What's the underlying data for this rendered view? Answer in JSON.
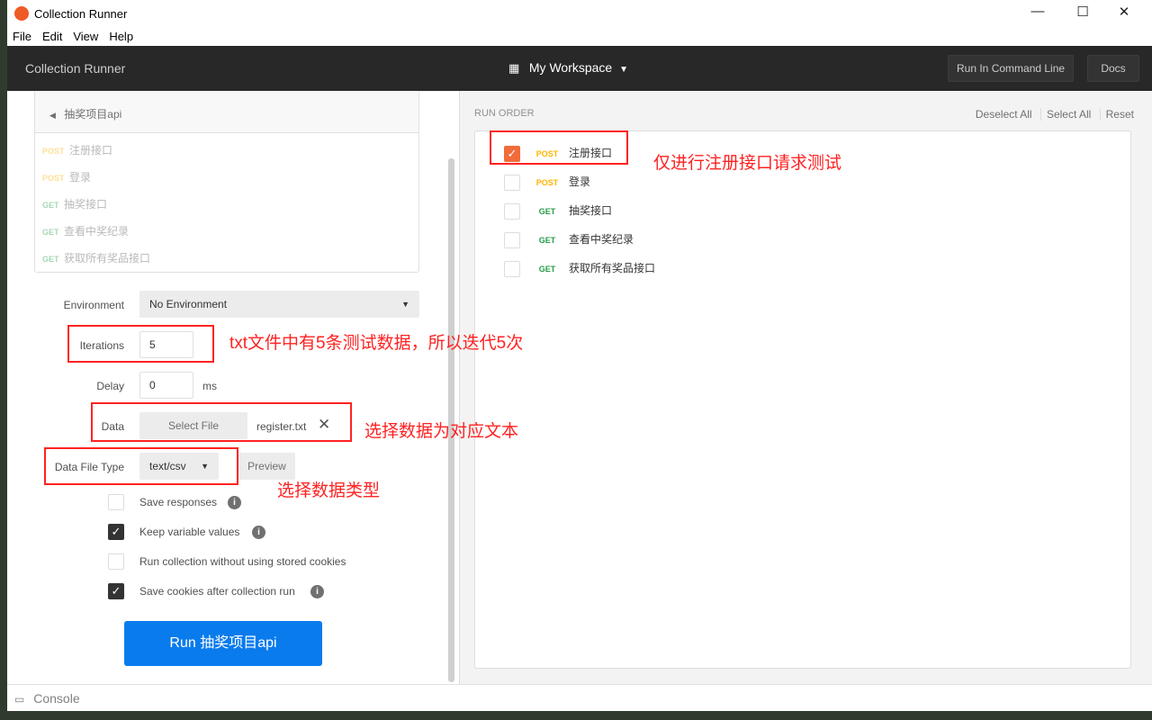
{
  "window": {
    "title": "Collection Runner",
    "controls": [
      "—",
      "☐",
      "✕"
    ]
  },
  "menu": [
    "File",
    "Edit",
    "View",
    "Help"
  ],
  "header": {
    "title": "Collection Runner",
    "workspace": "My Workspace",
    "run_cli": "Run In Command Line",
    "docs": "Docs"
  },
  "collection": {
    "name": "抽奖项目api",
    "requests": [
      {
        "method": "POST",
        "name": "注册接口"
      },
      {
        "method": "POST",
        "name": "登录"
      },
      {
        "method": "GET",
        "name": "抽奖接口"
      },
      {
        "method": "GET",
        "name": "查看中奖纪录"
      },
      {
        "method": "GET",
        "name": "获取所有奖品接口"
      }
    ]
  },
  "form": {
    "environment_label": "Environment",
    "environment_value": "No Environment",
    "iterations_label": "Iterations",
    "iterations_value": "5",
    "delay_label": "Delay",
    "delay_value": "0",
    "delay_unit": "ms",
    "data_label": "Data",
    "select_file": "Select File",
    "file_name": "register.txt",
    "data_file_type_label": "Data File Type",
    "data_file_type_value": "text/csv",
    "preview": "Preview",
    "options": [
      {
        "label": "Save responses",
        "checked": false,
        "info": true
      },
      {
        "label": "Keep variable values",
        "checked": true,
        "info": true
      },
      {
        "label": "Run collection without using stored cookies",
        "checked": false,
        "info": false
      },
      {
        "label": "Save cookies after collection run",
        "checked": true,
        "info": true
      }
    ],
    "run_button": "Run 抽奖项目api"
  },
  "run_order": {
    "title": "RUN ORDER",
    "deselect_all": "Deselect All",
    "select_all": "Select All",
    "reset": "Reset",
    "items": [
      {
        "method": "POST",
        "name": "注册接口",
        "checked": true
      },
      {
        "method": "POST",
        "name": "登录",
        "checked": false
      },
      {
        "method": "GET",
        "name": "抽奖接口",
        "checked": false
      },
      {
        "method": "GET",
        "name": "查看中奖纪录",
        "checked": false
      },
      {
        "method": "GET",
        "name": "获取所有奖品接口",
        "checked": false
      }
    ]
  },
  "annotations": {
    "run_order": "仅进行注册接口请求测试",
    "iterations": "txt文件中有5条测试数据，所以迭代5次",
    "data": "选择数据为对应文本",
    "data_type": "选择数据类型"
  },
  "footer": {
    "console": "Console"
  },
  "colors": {
    "accent": "#f26b3a",
    "run_button": "#097bed",
    "post": "#ffb400",
    "get": "#249c47",
    "annotation": "#ff2222"
  }
}
